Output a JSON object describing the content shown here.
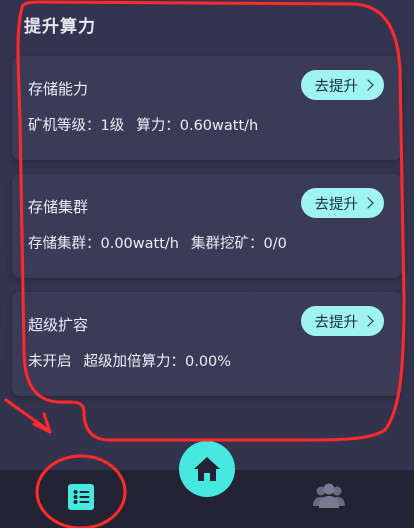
{
  "section_title": "提升算力",
  "cards": [
    {
      "title": "存储能力",
      "button_label": "去提升",
      "info": [
        "矿机等级：1级",
        "算力：0.60watt/h"
      ]
    },
    {
      "title": "存储集群",
      "button_label": "去提升",
      "info": [
        "存储集群：0.00watt/h",
        "集群挖矿：0/0"
      ]
    },
    {
      "title": "超级扩容",
      "button_label": "去提升",
      "info": [
        "未开启",
        "超级加倍算力：0.00%"
      ]
    }
  ],
  "colors": {
    "background": "#34344f",
    "card": "#3b3b57",
    "accent": "#47e8e0",
    "button": "#9ff3f0",
    "annotation": "#ff2a2a",
    "navbar": "#232333"
  },
  "nav": {
    "left_icon": "list-icon",
    "center_icon": "home-icon",
    "right_icon": "users-icon"
  }
}
